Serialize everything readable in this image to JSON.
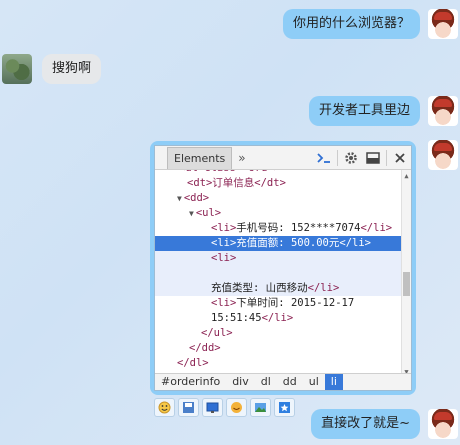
{
  "chat": {
    "messages": [
      {
        "side": "right",
        "text": "你用的什么浏览器？"
      },
      {
        "side": "left",
        "text": "搜狗啊"
      },
      {
        "side": "right",
        "text": "开发者工具里边"
      },
      {
        "side": "right",
        "text": "直接改了就是~"
      }
    ]
  },
  "devtools": {
    "tab": "Elements",
    "more": "»",
    "tree": [
      {
        "text": "<dt>订单信息</dt>"
      },
      {
        "arrow": "▼",
        "text": "<dd>"
      },
      {
        "arrow": "▼",
        "text": "<ul>"
      },
      {
        "tag": "<li>",
        "body": "手机号码: 152****7074",
        "tail": "</li>"
      },
      {
        "tag": "<li>",
        "body": "充值面额: 500.00元",
        "tail": "</li>"
      },
      {
        "text": "<li>"
      },
      {
        "body": "充值类型: 山西移动",
        "tail": "</li>"
      },
      {
        "tag": "<li>",
        "body": "下单时间: 2015-12-17"
      },
      {
        "body": "15:51:45",
        "tail": "</li>"
      },
      {
        "text": "</ul>"
      },
      {
        "text": "</dd>"
      },
      {
        "text": "</dl>"
      }
    ],
    "breadcrumbs": [
      "#orderinfo",
      "div",
      "dl",
      "dd",
      "ul",
      "li"
    ],
    "active_crumb": "li"
  },
  "emoji_toolbar": [
    "smile-icon",
    "save-icon",
    "screen-icon",
    "face-icon",
    "image-icon",
    "bookmark-icon"
  ]
}
